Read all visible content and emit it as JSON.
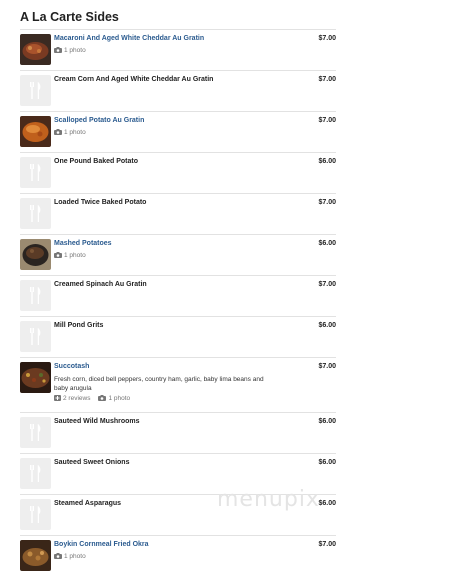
{
  "section": {
    "title": "A La Carte Sides"
  },
  "items": [
    {
      "name": "Macaroni And Aged White Cheddar Au Gratin",
      "price": "$7.00",
      "photos": "1 photo",
      "has_image": true,
      "image_tone": "#7a3a22"
    },
    {
      "name": "Cream Corn And Aged White Cheddar Au Gratin",
      "price": "$7.00",
      "has_image": false
    },
    {
      "name": "Scalloped Potato Au Gratin",
      "price": "$7.00",
      "photos": "1 photo",
      "has_image": true,
      "image_tone": "#c0601c"
    },
    {
      "name": "One Pound Baked Potato",
      "price": "$6.00",
      "has_image": false
    },
    {
      "name": "Loaded Twice Baked Potato",
      "price": "$7.00",
      "has_image": false
    },
    {
      "name": "Mashed Potatoes",
      "price": "$6.00",
      "photos": "1 photo",
      "has_image": true,
      "image_tone": "#5a3b26"
    },
    {
      "name": "Creamed Spinach Au Gratin",
      "price": "$7.00",
      "has_image": false
    },
    {
      "name": "Mill Pond Grits",
      "price": "$6.00",
      "has_image": false
    },
    {
      "name": "Succotash",
      "price": "$7.00",
      "description": "Fresh corn, diced bell peppers, country ham, garlic, baby lima beans and baby arugula",
      "reviews": "2 reviews",
      "photos": "1 photo",
      "has_image": true,
      "image_tone": "#6b3a20"
    },
    {
      "name": "Sauteed Wild Mushrooms",
      "price": "$6.00",
      "has_image": false
    },
    {
      "name": "Sauteed Sweet Onions",
      "price": "$6.00",
      "has_image": false
    },
    {
      "name": "Steamed Asparagus",
      "price": "$6.00",
      "has_image": false
    },
    {
      "name": "Boykin Cornmeal Fried Okra",
      "price": "$7.00",
      "photos": "1 photo",
      "has_image": true,
      "image_tone": "#8a5a2a"
    }
  ],
  "watermark": "menupix",
  "colors": {
    "link": "#2b5b8f",
    "divider": "#e2e2e2",
    "placeholder_bg": "#eeeeee"
  }
}
